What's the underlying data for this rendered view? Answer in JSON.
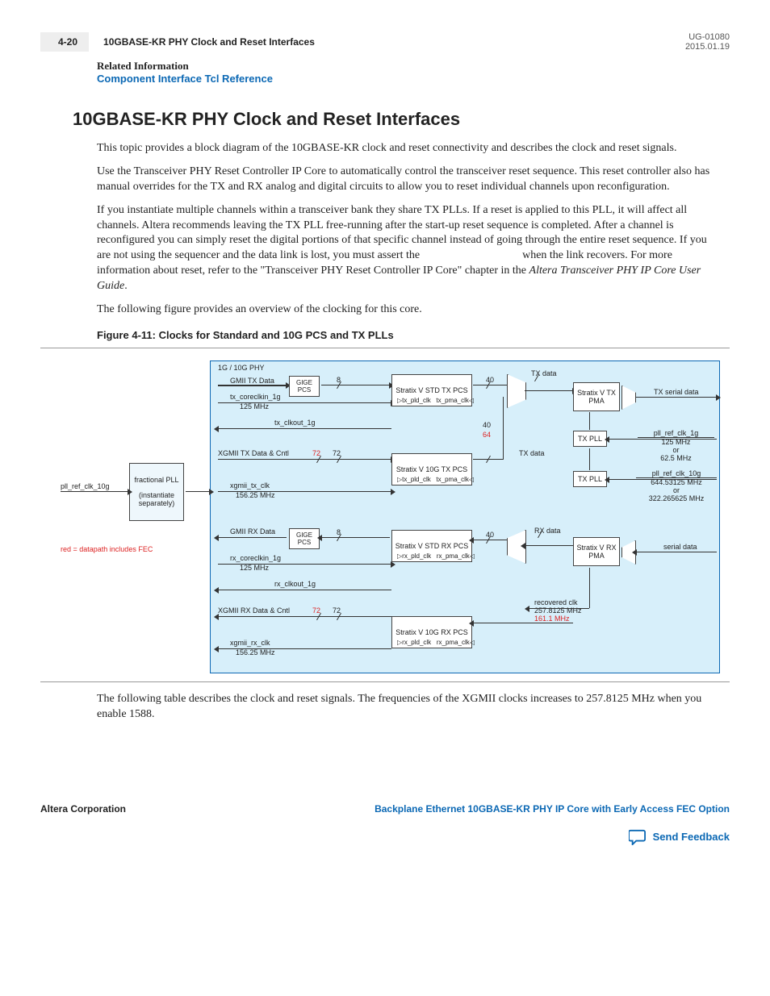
{
  "header": {
    "page_num": "4-20",
    "title": "10GBASE-KR PHY Clock and Reset Interfaces",
    "doc_id": "UG-01080",
    "date": "2015.01.19"
  },
  "related": {
    "heading": "Related Information",
    "link": "Component Interface Tcl Reference"
  },
  "section_title": "10GBASE-KR PHY Clock and Reset Interfaces",
  "para1": "This topic provides a block diagram of the 10GBASE-KR clock and reset connectivity and describes the clock and reset signals.",
  "para2": "Use the Transceiver PHY Reset Controller IP Core to automatically control the transceiver reset sequence. This reset controller also has manual overrides for the TX and RX analog and digital circuits to allow you to reset individual channels upon reconfiguration.",
  "para3a": "If you instantiate multiple channels within a transceiver bank they share TX PLLs. If a reset is applied to this PLL, it will affect all channels. Altera recommends leaving the TX PLL free-running after the start-up reset sequence is completed. After a channel is reconfigured you can simply reset the digital portions of that specific channel instead of going through the entire reset sequence. If you are not using the sequencer and the data link is lost, you must assert the ",
  "para3b": " when the link recovers. For more information about reset, refer to the \"Transceiver PHY Reset Controller IP Core\" chapter in the ",
  "para3c": "Altera Transceiver PHY IP Core User Guide",
  "para3d": ".",
  "para4": "The following figure provides an overview of the clocking for this core.",
  "fig_caption": "Figure 4-11: Clocks for Standard and 10G PCS and TX PLLs",
  "para5": "The following table describes the clock and reset signals. The frequencies of the XGMII clocks increases to 257.8125 MHz when you enable 1588.",
  "diagram": {
    "phy_title": "1G / 10G PHY",
    "left_sig1": "GMII TX Data",
    "left_sig2": "tx_coreclkin_1g",
    "left_freq2": "125 MHz",
    "left_clkout1": "tx_clkout_1g",
    "left_sig3": "XGMII TX Data & Cntl",
    "left_sig4": "xgmii_tx_clk",
    "left_freq4": "156.25 MHz",
    "left_sig5": "GMII RX Data",
    "left_sig6": "rx_coreclkin_1g",
    "left_freq6": "125 MHz",
    "left_clkout2": "rx_clkout_1g",
    "left_sig7": "XGMII RX Data & Cntl",
    "left_sig8": "xgmii_rx_clk",
    "left_freq8": "156.25 MHz",
    "ext_sig": "pll_ref_clk_10g",
    "frac_pll": "fractional PLL",
    "frac_note": "(instantiate separately)",
    "red_legend": "red = datapath includes FEC",
    "gige_pcs": "GIGE PCS",
    "std_tx_pcs": "Stratix V STD TX PCS",
    "g10_tx_pcs": "Stratix V 10G TX PCS",
    "std_rx_pcs": "Stratix V STD RX PCS",
    "g10_rx_pcs": "Stratix V 10G RX PCS",
    "tx_pma": "Stratix V TX PMA",
    "rx_pma": "Stratix V RX PMA",
    "tx_pll": "TX PLL",
    "tx_pld": "tx_pld_clk",
    "tx_pma_clk": "tx_pma_clk",
    "rx_pld": "rx_pld_clk",
    "rx_pma_clk": "rx_pma_clk",
    "bus8": "8",
    "bus40": "40",
    "bus64": "64",
    "bus72": "72",
    "tx_data": "TX  data",
    "rx_data": "RX  data",
    "tx_serial": "TX serial data",
    "rx_serial": "serial data",
    "ref1g": "pll_ref_clk_1g",
    "ref1g_f1": "125 MHz",
    "ref1g_or": "or",
    "ref1g_f2": "62.5 MHz",
    "ref10g": "pll_ref_clk_10g",
    "ref10g_f1": "644.53125 MHz",
    "ref10g_or": "or",
    "ref10g_f2": "322.265625 MHz",
    "rec_clk": "recovered clk",
    "rec_f1": "257.8125 MHz",
    "rec_f2": "161.1 MHz"
  },
  "footer": {
    "left": "Altera Corporation",
    "right": "Backplane Ethernet 10GBASE-KR PHY IP Core with Early Access FEC Option",
    "feedback": "Send Feedback"
  }
}
